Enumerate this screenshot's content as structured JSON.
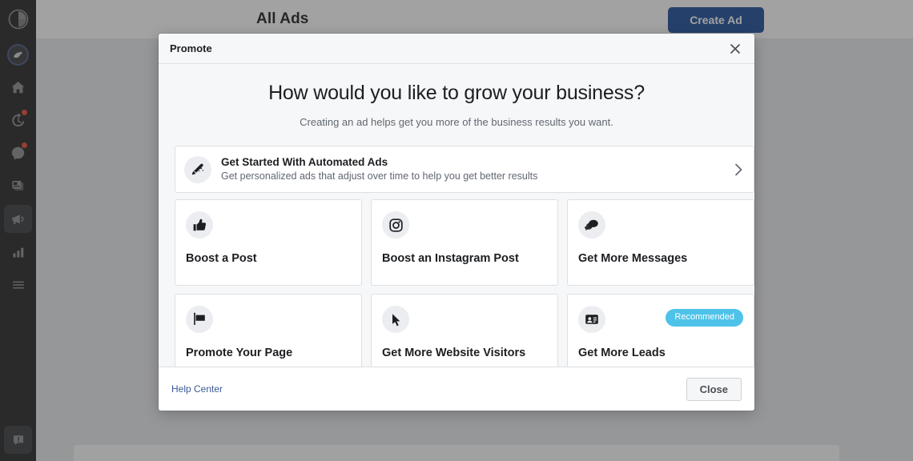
{
  "background": {
    "page_title": "All Ads",
    "create_ad_label": "Create Ad",
    "create_ad_color": "#1d4f9c"
  },
  "rail": {
    "items": [
      {
        "name": "logo-icon",
        "label": ""
      },
      {
        "name": "avatar",
        "label": ""
      },
      {
        "name": "home-icon",
        "label": ""
      },
      {
        "name": "history-icon",
        "label": ""
      },
      {
        "name": "messenger-icon",
        "label": ""
      },
      {
        "name": "pages-icon",
        "label": ""
      },
      {
        "name": "megaphone-icon",
        "label": ""
      },
      {
        "name": "insights-icon",
        "label": ""
      },
      {
        "name": "menu-icon",
        "label": ""
      },
      {
        "name": "feedback-icon",
        "label": ""
      }
    ]
  },
  "modal": {
    "title": "Promote",
    "close_icon": "close-icon",
    "headline": "How would you like to grow your business?",
    "subhead": "Creating an ad helps get you more of the business results you want.",
    "featured": {
      "icon": "magic-wand-icon",
      "title": "Get Started With Automated Ads",
      "subtitle": "Get personalized ads that adjust over time to help you get better results",
      "chevron": "chevron-right-icon"
    },
    "cards": [
      {
        "icon": "thumbs-up-icon",
        "label": "Boost a Post",
        "badge": ""
      },
      {
        "icon": "instagram-icon",
        "label": "Boost an Instagram Post",
        "badge": ""
      },
      {
        "icon": "messages-icon",
        "label": "Get More Messages",
        "badge": ""
      },
      {
        "icon": "flag-icon",
        "label": "Promote Your Page",
        "badge": ""
      },
      {
        "icon": "cursor-icon",
        "label": "Get More Website Visitors",
        "badge": ""
      },
      {
        "icon": "contact-card-icon",
        "label": "Get More Leads",
        "badge": "Recommended"
      }
    ],
    "badge_color": "#4ec2e8",
    "footer": {
      "help_center_label": "Help Center",
      "help_center_color": "#3b5998",
      "close_label": "Close"
    }
  }
}
